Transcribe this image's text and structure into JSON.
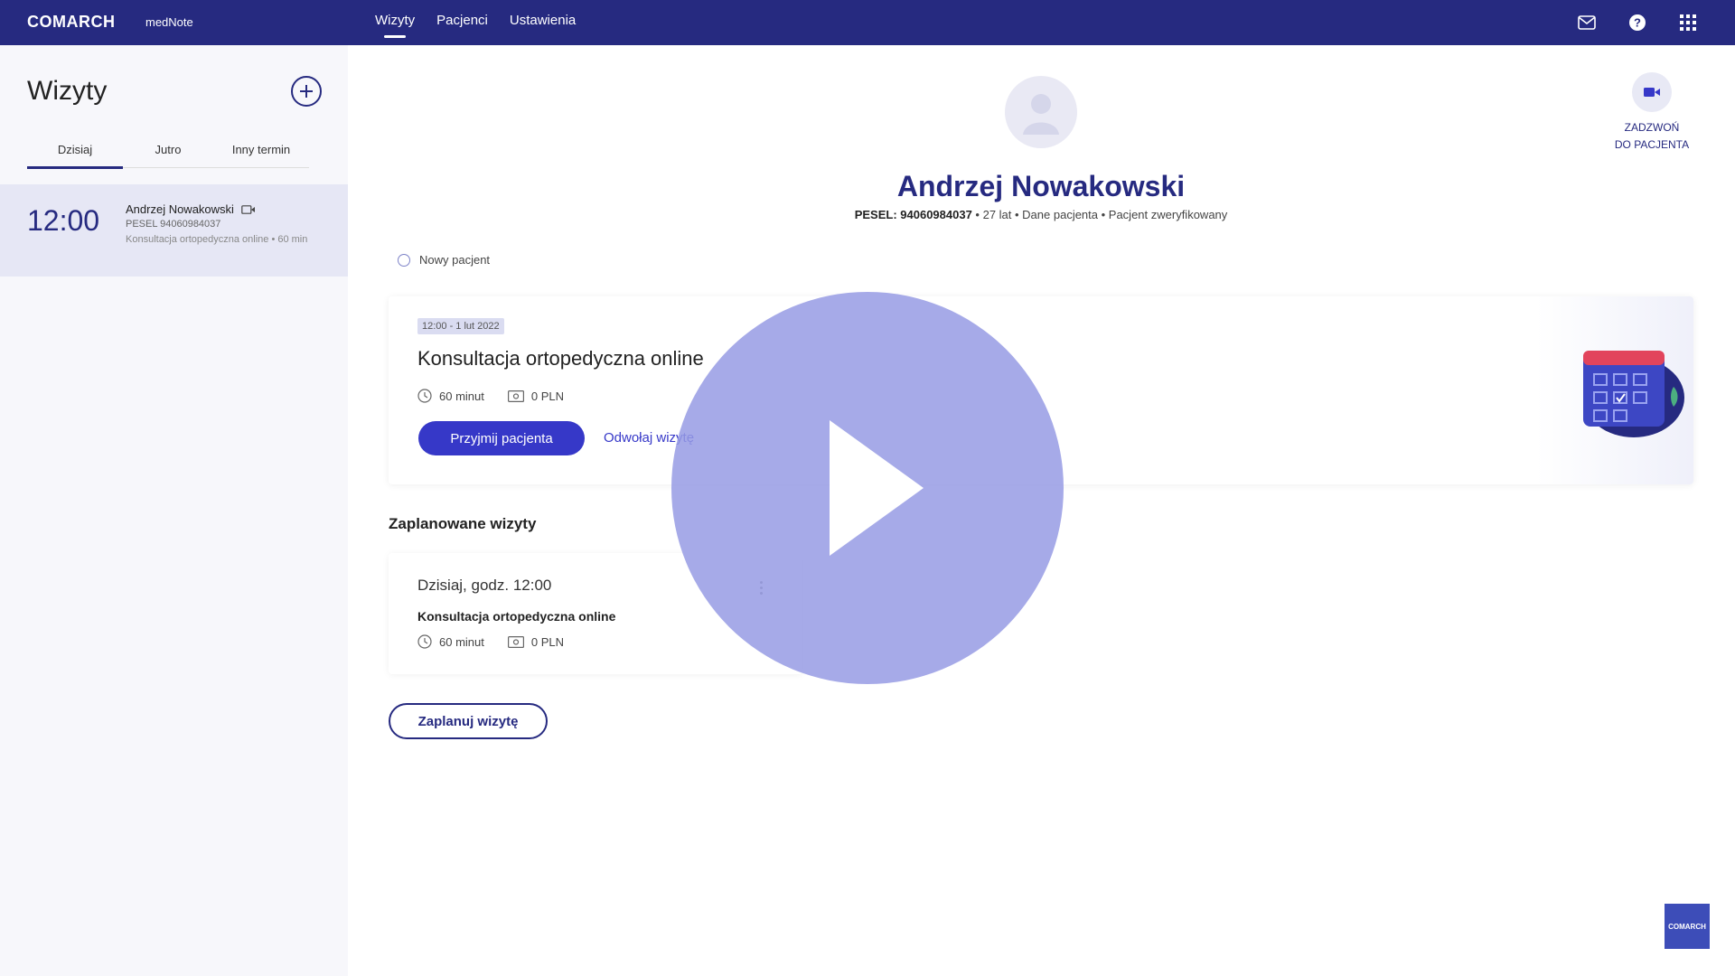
{
  "header": {
    "brand": "COMARCH",
    "product": "medNote",
    "nav": [
      "Wizyty",
      "Pacjenci",
      "Ustawienia"
    ]
  },
  "icons": {
    "mail": "mail-icon",
    "help": "help-icon",
    "apps": "apps-grid-icon",
    "add": "plus-circle-icon",
    "video": "video-camera-icon",
    "clock": "clock-icon",
    "money": "money-icon",
    "play": "play-icon",
    "avatar": "user-avatar-icon",
    "calendar": "calendar-illustration-icon"
  },
  "colors": {
    "brand": "#262a80",
    "primary": "#3638c8",
    "sidebar_bg": "#f7f7fb",
    "selected_bg": "#e6e7f5",
    "overlay": "#969be4"
  },
  "sidebar": {
    "title": "Wizyty",
    "tabs": [
      "Dzisiaj",
      "Jutro",
      "Inny termin"
    ],
    "visit": {
      "time": "12:00",
      "name": "Andrzej Nowakowski",
      "pesel": "PESEL 94060984037",
      "desc": "Konsultacja ortopedyczna online • 60 min"
    }
  },
  "patient": {
    "name": "Andrzej Nowakowski",
    "pesel_label": "PESEL: 94060984037",
    "meta_rest": " • 27 lat • Dane pacjenta • Pacjent zweryfikowany",
    "new_patient": "Nowy pacjent",
    "call_line1": "ZADZWOŃ",
    "call_line2": "DO PACJENTA"
  },
  "current_visit": {
    "date": "12:00 - 1 lut 2022",
    "title": "Konsultacja ortopedyczna online",
    "duration": "60 minut",
    "price": "0 PLN",
    "accept": "Przyjmij pacjenta",
    "cancel": "Odwołaj wizytę"
  },
  "planned": {
    "title": "Zaplanowane wizyty",
    "date": "Dzisiaj, godz. 12:00",
    "visit_title": "Konsultacja ortopedyczna online",
    "duration": "60 minut",
    "price": "0 PLN",
    "plan_button": "Zaplanuj wizytę"
  },
  "watermark": "COMARCH"
}
